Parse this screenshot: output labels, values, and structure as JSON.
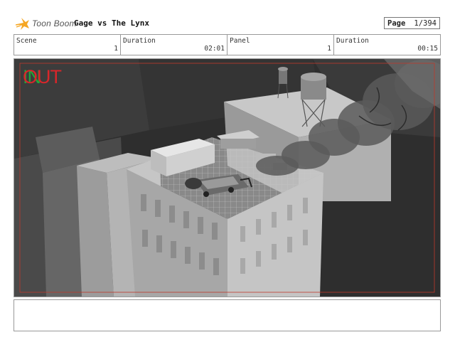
{
  "header": {
    "logo_text": "Toon Boom",
    "logo_icon": "toon-boom-star-icon",
    "project_title": "Gage vs The Lynx",
    "page_label": "Page",
    "page_value": "1/394"
  },
  "info": {
    "scene_label": "Scene",
    "scene_value": "1",
    "scene_duration_label": "Duration",
    "scene_duration_value": "02:01",
    "panel_label": "Panel",
    "panel_value": "1",
    "panel_duration_label": "Duration",
    "panel_duration_value": "00:15"
  },
  "panel": {
    "in_marker": "IN",
    "out_marker": "OUT",
    "in_color": "#1fa83a",
    "out_color": "#d8262a",
    "frame_border_color": "#c0392b"
  },
  "notes": {
    "text": ""
  }
}
